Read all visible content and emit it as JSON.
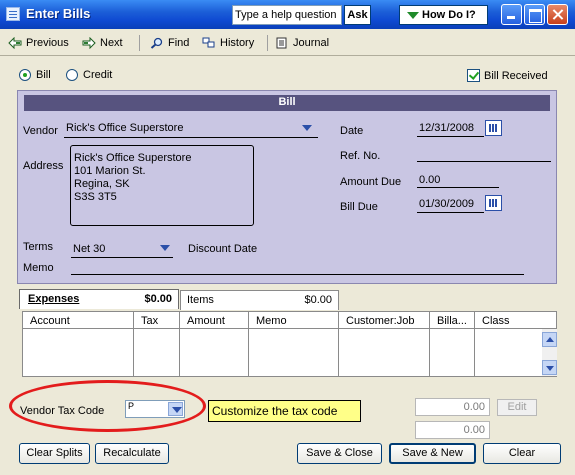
{
  "window": {
    "title": "Enter Bills",
    "help_placeholder": "Type a help question",
    "ask_label": "Ask",
    "howdo_label": "How Do I?"
  },
  "toolbar": {
    "previous": "Previous",
    "next": "Next",
    "find": "Find",
    "history": "History",
    "journal": "Journal"
  },
  "mode": {
    "bill_label": "Bill",
    "credit_label": "Credit",
    "selected": "Bill",
    "bill_received_label": "Bill Received",
    "bill_received_checked": true
  },
  "bill": {
    "header": "Bill",
    "vendor_label": "Vendor",
    "vendor_value": "Rick's Office Superstore",
    "address_label": "Address",
    "address_lines": [
      "Rick's Office Superstore",
      "101 Marion St.",
      "Regina, SK",
      "S3S 3T5"
    ],
    "date_label": "Date",
    "date_value": "12/31/2008",
    "ref_label": "Ref. No.",
    "ref_value": "",
    "amount_due_label": "Amount Due",
    "amount_due_value": "0.00",
    "bill_due_label": "Bill Due",
    "bill_due_value": "01/30/2009",
    "terms_label": "Terms",
    "terms_value": "Net 30",
    "discount_date_label": "Discount Date",
    "memo_label": "Memo"
  },
  "tabs": [
    {
      "name": "Expenses",
      "amount": "$0.00",
      "active": true
    },
    {
      "name": "Items",
      "amount": "$0.00",
      "active": false
    }
  ],
  "grid_columns": [
    "Account",
    "Tax",
    "Amount",
    "Memo",
    "Customer:Job",
    "Billa...",
    "Class"
  ],
  "bottom": {
    "vendor_tax_code_label": "Vendor Tax Code",
    "tax_code_value": "P",
    "callout_text": "Customize the tax code",
    "total_1": "0.00",
    "total_2": "0.00",
    "edit_label": "Edit",
    "clear_splits": "Clear Splits",
    "recalculate": "Recalculate",
    "save_close": "Save & Close",
    "save_new": "Save & New",
    "clear": "Clear"
  },
  "colors": {
    "title_bar": "#1c5fd8",
    "bill_panel": "#c9c6e3",
    "bill_header": "#57537f",
    "callout": "#ffff88",
    "ellipse": "#e31c1c"
  }
}
